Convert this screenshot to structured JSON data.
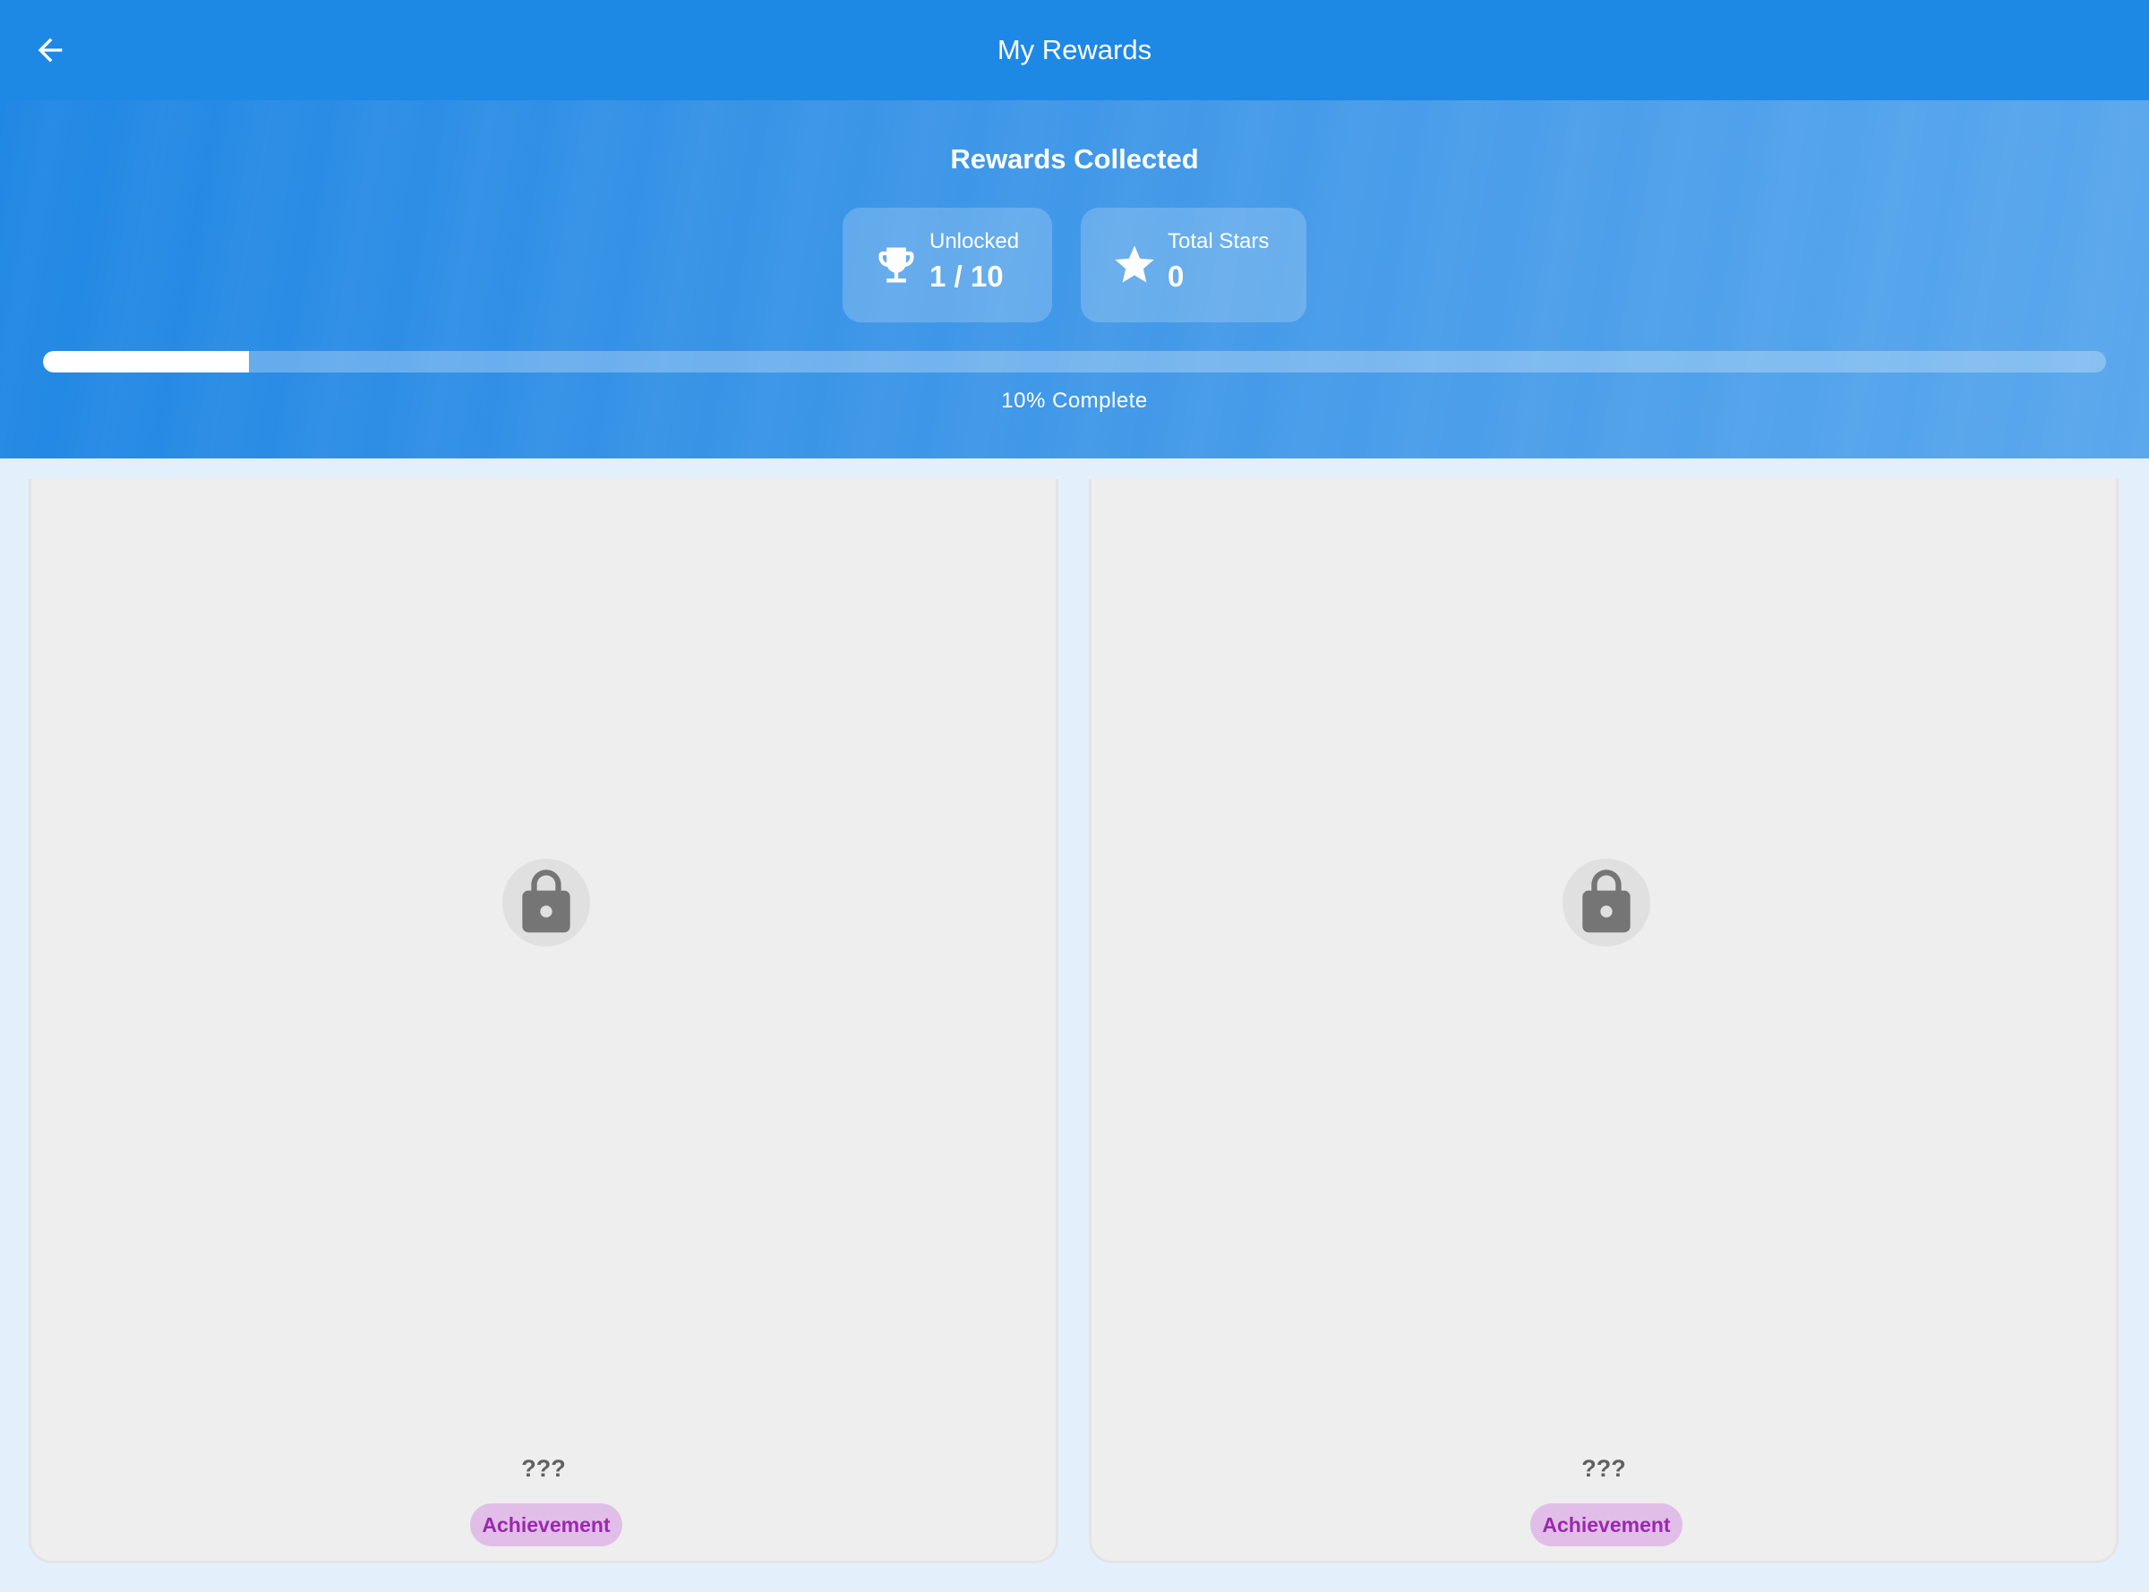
{
  "appbar": {
    "title": "My Rewards",
    "back_icon": "arrow-back-icon"
  },
  "summary": {
    "title": "Rewards Collected",
    "unlocked": {
      "label": "Unlocked",
      "value": "1 / 10",
      "icon": "trophy-icon"
    },
    "stars": {
      "label": "Total Stars",
      "value": "0",
      "icon": "star-icon"
    },
    "progress": {
      "fraction": 0.1,
      "label": "10% Complete"
    }
  },
  "rewards": [
    {
      "name": "???",
      "tag": "Achievement",
      "locked": true,
      "icon": "lock-icon"
    },
    {
      "name": "???",
      "tag": "Achievement",
      "locked": true,
      "icon": "lock-icon"
    }
  ],
  "colors": {
    "appbar": "#1e88e5",
    "background": "#e3f0fb",
    "card": "#eeeeee",
    "tag_bg": "#e1bee7",
    "tag_text": "#9c27b0",
    "lock": "#757575"
  }
}
